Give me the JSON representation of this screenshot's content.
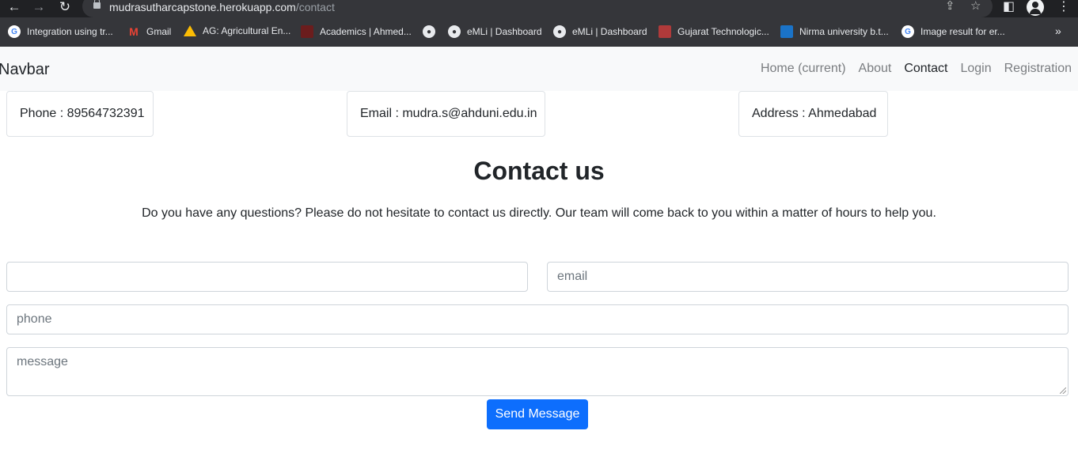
{
  "browser": {
    "url_host": "mudrasutharcapstone.herokuapp.com",
    "url_path": "/contact",
    "bookmarks": [
      {
        "label": "Integration using tr...",
        "icon": "google-icon"
      },
      {
        "label": "Gmail",
        "icon": "gmail-icon"
      },
      {
        "label": "AG: Agricultural En...",
        "icon": "drive-icon"
      },
      {
        "label": "Academics | Ahmed...",
        "icon": "ahduni-icon"
      },
      {
        "label": "",
        "icon": "globe-icon"
      },
      {
        "label": "eMLi | Dashboard",
        "icon": "globe-icon"
      },
      {
        "label": "eMLi | Dashboard",
        "icon": "globe-icon"
      },
      {
        "label": "Gujarat Technologic...",
        "icon": "gtu-icon"
      },
      {
        "label": "Nirma university b.t...",
        "icon": "nirma-icon"
      },
      {
        "label": "Image result for er...",
        "icon": "google-icon"
      }
    ],
    "more": "»"
  },
  "navbar": {
    "brand": "Navbar",
    "links": [
      "Home (current)",
      "About",
      "Contact",
      "Login",
      "Registration"
    ],
    "active": "Contact"
  },
  "info": {
    "phone": "Phone : 89564732391",
    "email": "Email : mudra.s@ahduni.edu.in",
    "address": "Address : Ahmedabad"
  },
  "contact": {
    "title": "Contact us",
    "lead": "Do you have any questions? Please do not hesitate to contact us directly. Our team will come back to you within a matter of hours to help you."
  },
  "form": {
    "name_placeholder": "",
    "email_placeholder": "email",
    "phone_placeholder": "phone",
    "message_placeholder": "message",
    "submit_label": "Send Message"
  }
}
